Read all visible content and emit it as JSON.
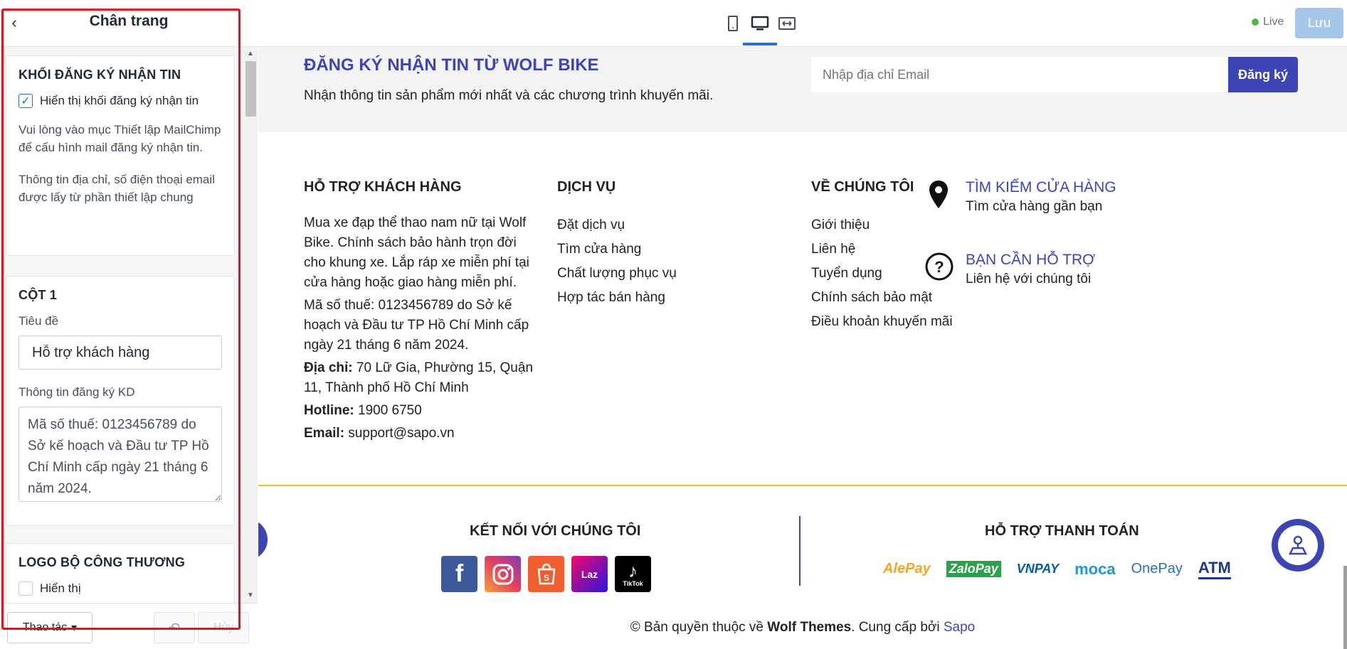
{
  "panel": {
    "title": "Chân trang",
    "newsletter_card": {
      "title": "KHỐI ĐĂNG KÝ NHẬN TIN",
      "show_label": "Hiển thị khối đăng ký nhận tin",
      "help1": "Vui lòng vào mục Thiết lập MailChimp để cấu hình mail đăng ký nhận tin.",
      "help2": "Thông tin địa chỉ, số điện thoại email được lấy từ phần thiết lập chung"
    },
    "col1_card": {
      "title": "CỘT 1",
      "title_label": "Tiêu đề",
      "title_value": "Hỗ trợ khách hàng",
      "kd_label": "Thông tin đăng ký KD",
      "kd_value": "Mã số thuế: 0123456789 do Sở kế hoạch và Đầu tư TP Hồ Chí Minh cấp ngày 21 tháng 6 năm 2024."
    },
    "logo_card": {
      "title": "LOGO BỘ CÔNG THƯƠNG",
      "show_label": "Hiển thị"
    },
    "footer": {
      "actions_label": "Thao tác",
      "cancel_label": "Hủy"
    }
  },
  "topbar": {
    "live_label": "Live",
    "save_label": "Lưu"
  },
  "preview": {
    "newsletter": {
      "title": "ĐĂNG KÝ NHẬN TIN TỪ WOLF BIKE",
      "subtitle": "Nhận thông tin sản phẩm mới nhất và các chương trình khuyến mãi.",
      "email_placeholder": "Nhập địa chỉ Email",
      "submit_label": "Đăng ký"
    },
    "support_col": {
      "title": "Hỗ trợ khách hàng",
      "desc": "Mua xe đạp thể thao nam nữ tại Wolf Bike. Chính sách bảo hành trọn đời cho khung xe. Lắp ráp xe miễn phí tại cửa hàng hoặc giao hàng miễn phí.",
      "tax": "Mã số thuế: 0123456789 do Sở kế hoạch và Đầu tư TP Hồ Chí Minh cấp ngày 21 tháng 6 năm 2024.",
      "address_label": "Địa chỉ:",
      "address_value": " 70 Lữ Gia, Phường 15, Quận 11, Thành phố Hồ Chí Minh",
      "hotline_label": "Hotline:",
      "hotline_value": " 1900 6750",
      "email_label": "Email:",
      "email_value": " support@sapo.vn"
    },
    "service_col": {
      "title": "Dịch vụ",
      "links": [
        "Đặt dịch vụ",
        "Tìm cửa hàng",
        "Chất lượng phục vụ",
        "Hợp tác bán hàng"
      ]
    },
    "about_col": {
      "title": "Về chúng tôi",
      "links": [
        "Giới thiệu",
        "Liên hệ",
        "Tuyển dụng",
        "Chính sách bảo mật",
        "Điều khoản khuyến mãi"
      ]
    },
    "store_info": {
      "title": "TÌM KIẾM CỬA HÀNG",
      "subtitle": "Tìm cửa hàng gần bạn"
    },
    "help_info": {
      "title": "BẠN CẦN HỖ TRỢ",
      "subtitle": "Liên hệ với chúng tôi"
    },
    "connect_title": "KẾT NỐI VỚI CHÚNG TÔI",
    "payment_title": "HỖ TRỢ THANH TOÁN",
    "payments": [
      "AlePay",
      "ZaloPay",
      "VNPAY",
      "moca",
      "OnePay",
      "ATM"
    ],
    "social": [
      "f",
      "Laz",
      "TikTok"
    ],
    "copyright_prefix": "© Bản quyền thuộc về ",
    "copyright_brand": "Wolf Themes",
    "copyright_mid": ". Cung cấp bởi ",
    "copyright_provider": "Sapo"
  },
  "colors": {
    "brand": "#3d45b6",
    "highlight": "#e8101a",
    "accent_line": "#f1c40f"
  }
}
